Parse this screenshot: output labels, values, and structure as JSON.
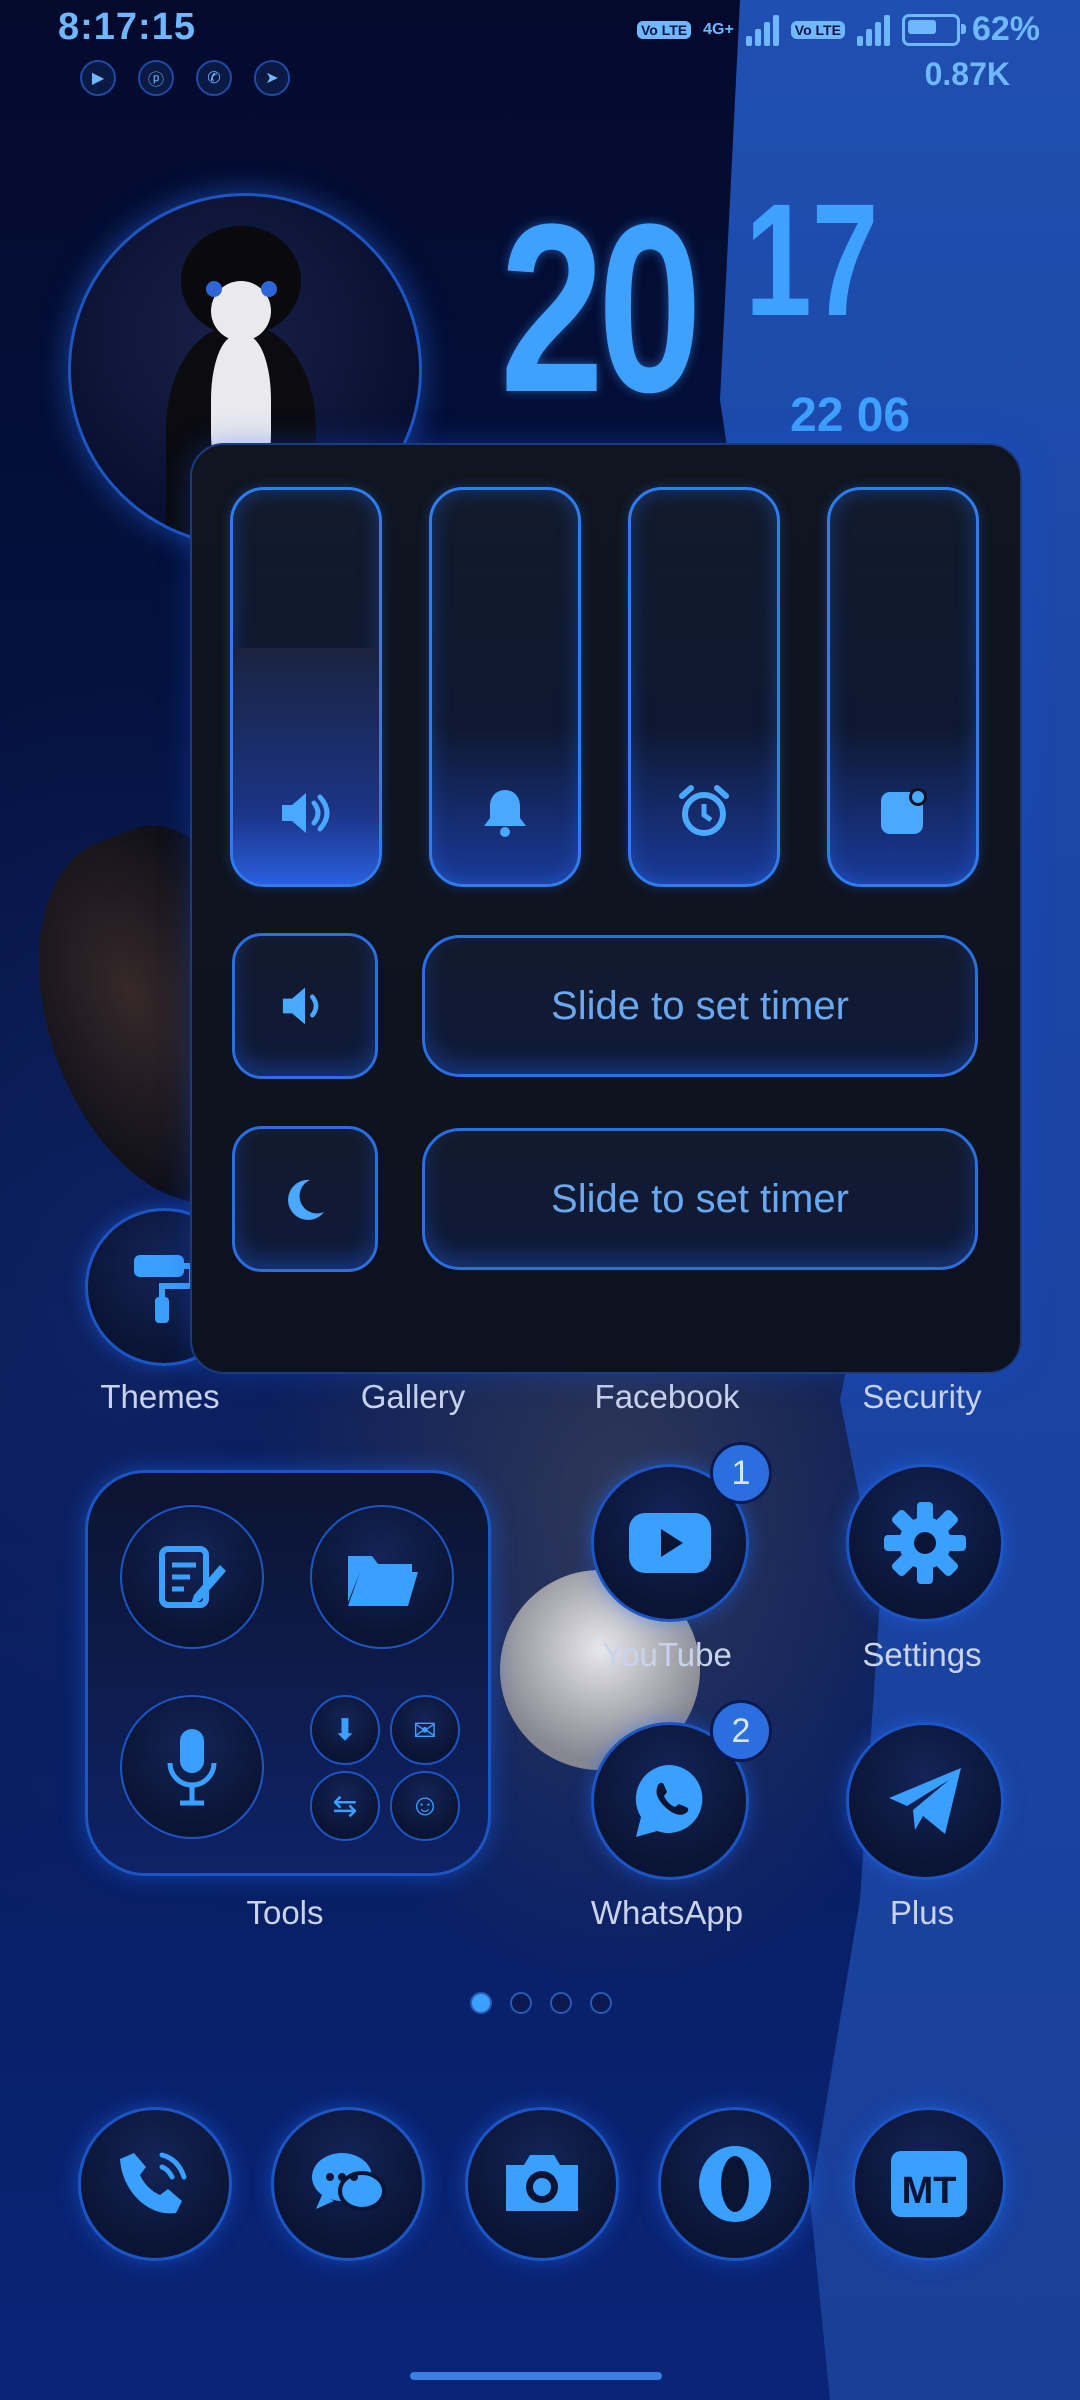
{
  "status_bar": {
    "time": "8:17:15",
    "network_type": "4G+",
    "volte_label_1": "Vo LTE",
    "volte_label_2": "Vo LTE",
    "battery": "62%",
    "net_speed": "0.87K",
    "notification_icons": [
      "youtube-icon",
      "p-app-icon",
      "whatsapp-icon",
      "telegram-icon"
    ]
  },
  "clock": {
    "hour": "20",
    "minute": "17",
    "date": "22 06"
  },
  "sound_panel": {
    "sliders": [
      {
        "name": "media-volume",
        "icon": "speaker-icon",
        "level": 0.6
      },
      {
        "name": "ring-volume",
        "icon": "bell-icon",
        "level": 0.0
      },
      {
        "name": "alarm-volume",
        "icon": "alarm-clock-icon",
        "level": 0.0
      },
      {
        "name": "notification-volume",
        "icon": "notification-icon",
        "level": 0.0
      }
    ],
    "timer_rows": [
      {
        "icon": "speaker-icon",
        "label": "Slide to set timer"
      },
      {
        "icon": "moon-icon",
        "label": "Slide to set timer"
      }
    ]
  },
  "apps_row1": [
    "Themes",
    "Gallery",
    "Facebook",
    "Security"
  ],
  "folder": {
    "label": "Tools"
  },
  "apps": {
    "youtube": {
      "label": "YouTube",
      "badge": "1"
    },
    "settings": {
      "label": "Settings"
    },
    "whatsapp": {
      "label": "WhatsApp",
      "badge": "2"
    },
    "plus": {
      "label": "Plus"
    }
  },
  "page_indicator": {
    "pages": 4,
    "current": 1
  },
  "dock": [
    "phone-icon",
    "messages-icon",
    "camera-icon",
    "opera-icon",
    "mt-manager-icon"
  ],
  "dock_mt_text": "MT",
  "colors": {
    "accent": "#3aa0ff",
    "background": "#061649",
    "panel": "#0f1522"
  }
}
